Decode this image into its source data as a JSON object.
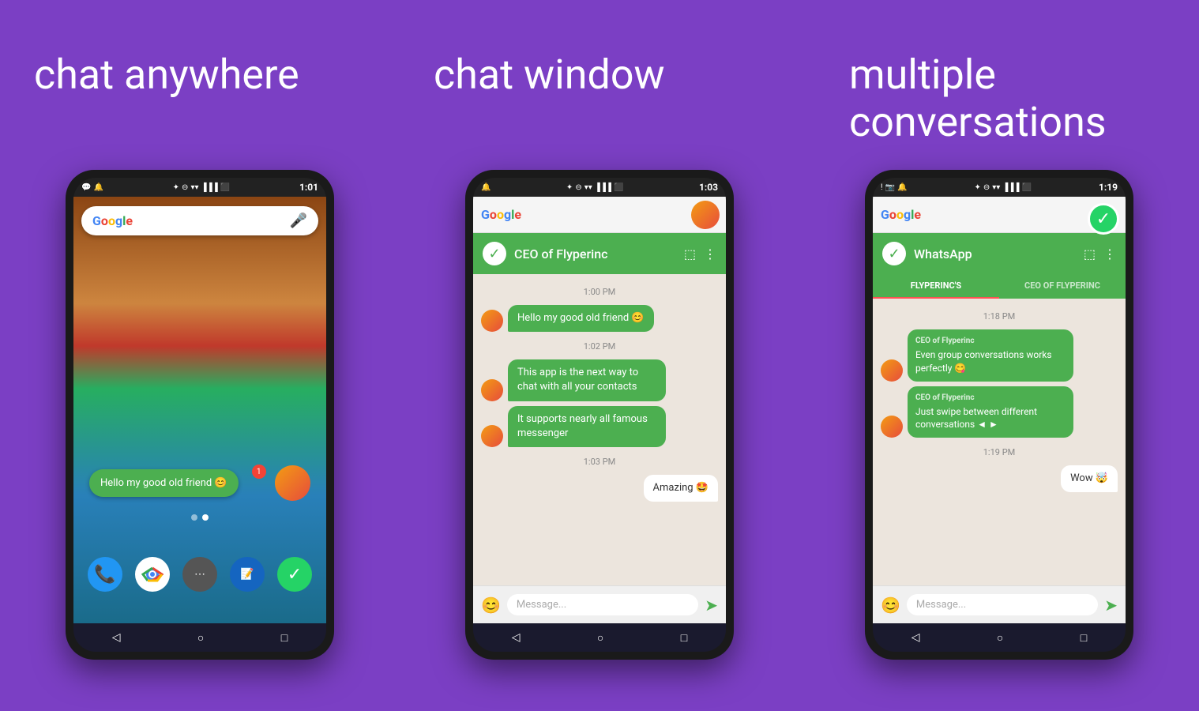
{
  "background": "#7B3FC4",
  "sections": [
    {
      "id": "chat-anywhere",
      "title": "chat anywhere",
      "phone": {
        "time": "1:01",
        "chat_bubble": "Hello my good old friend 😊",
        "notification": "1"
      }
    },
    {
      "id": "chat-window",
      "title": "chat window",
      "phone": {
        "time": "1:03",
        "contact": "CEO of Flyperinc",
        "messages": [
          {
            "type": "received",
            "text": "Hello my good old friend 😊",
            "time": "1:00 PM"
          },
          {
            "type": "received",
            "text": "This app is the next way to chat with all your contacts",
            "time": "1:02 PM"
          },
          {
            "type": "received",
            "text": "It supports nearly all famous messenger",
            "time": ""
          },
          {
            "type": "sent",
            "text": "Amazing 🤩",
            "time": "1:03 PM"
          }
        ],
        "input_placeholder": "Message..."
      }
    },
    {
      "id": "multiple-conversations",
      "title": "multiple\nconversations",
      "phone": {
        "time": "1:19",
        "contact": "WhatsApp",
        "tabs": [
          "FLYPERINC'S",
          "CEO OF FLYPERINC"
        ],
        "messages": [
          {
            "type": "received",
            "sender": "CEO of Flyperinc",
            "text": "Even group conversations works perfectly 😋",
            "time": "1:18 PM"
          },
          {
            "type": "received",
            "sender": "CEO of Flyperinc",
            "text": "Just swipe between different conversations ◄ ►",
            "time": ""
          },
          {
            "type": "sent",
            "text": "Wow 🤯",
            "time": "1:19 PM"
          }
        ],
        "input_placeholder": "Message..."
      }
    }
  ],
  "labels": {
    "google": "Google",
    "google_letters": [
      "G",
      "o",
      "o",
      "g",
      "l",
      "e"
    ],
    "message_placeholder": "Message...",
    "back_btn": "◁",
    "home_btn": "○",
    "recents_btn": "□"
  }
}
